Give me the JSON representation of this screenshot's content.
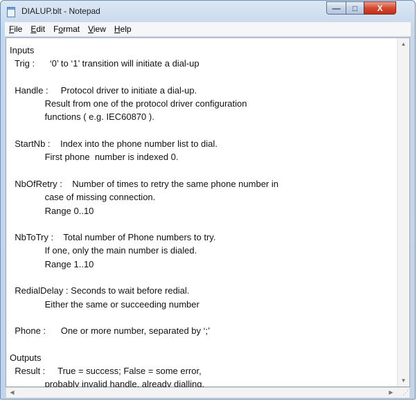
{
  "window": {
    "title": "DIALUP.blt - Notepad",
    "controls": {
      "minimize": "—",
      "maximize": "□",
      "close": "X"
    }
  },
  "menu": {
    "file": {
      "key": "F",
      "rest": "ile"
    },
    "edit": {
      "key": "E",
      "rest": "dit"
    },
    "format": {
      "pre": "F",
      "key": "o",
      "rest": "rmat"
    },
    "view": {
      "key": "V",
      "rest": "iew"
    },
    "help": {
      "key": "H",
      "rest": "elp"
    }
  },
  "document": {
    "text": "Inputs\n  Trig :      ‘0’ to ‘1’ transition will initiate a dial-up\n\n  Handle :     Protocol driver to initiate a dial-up.\n              Result from one of the protocol driver configuration\n              functions ( e.g. IEC60870 ).\n\n  StartNb :    Index into the phone number list to dial.\n              First phone  number is indexed 0.\n\n  NbOfRetry :    Number of times to retry the same phone number in\n              case of missing connection.\n              Range 0..10\n\n  NbToTry :    Total number of Phone numbers to try.\n              If one, only the main number is dialed.\n              Range 1..10\n\n  RedialDelay : Seconds to wait before redial.\n              Either the same or succeeding number\n\n  Phone :      One or more number, separated by ‘;’\n\nOutputs\n  Result :     True = success; False = some error,\n              probably invalid handle, already dialling."
  },
  "scrollbars": {
    "up": "▲",
    "down": "▼",
    "left": "◀",
    "right": "▶",
    "grip": "⋰"
  }
}
